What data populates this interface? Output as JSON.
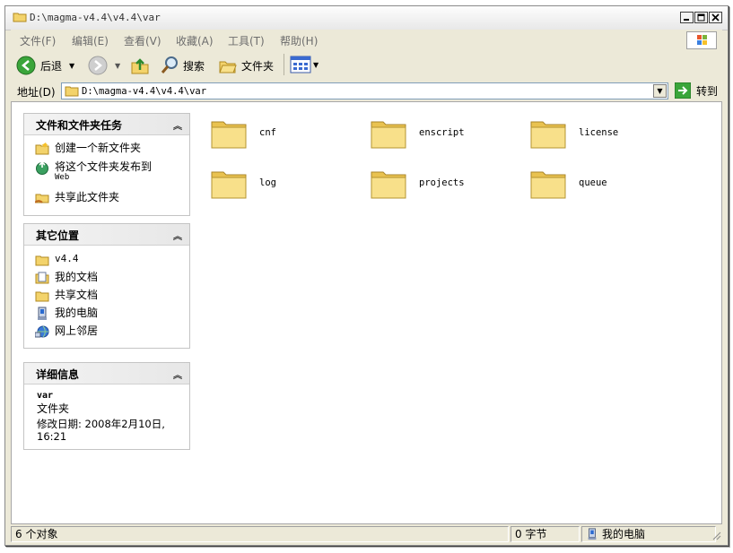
{
  "window": {
    "title": "D:\\magma-v4.4\\v4.4\\var"
  },
  "menu": {
    "file": "文件(F)",
    "edit": "编辑(E)",
    "view": "查看(V)",
    "favorites": "收藏(A)",
    "tools": "工具(T)",
    "help": "帮助(H)"
  },
  "toolbar": {
    "back": "后退",
    "search": "搜索",
    "folders": "文件夹"
  },
  "address": {
    "label": "地址(D)",
    "value": "D:\\magma-v4.4\\v4.4\\var",
    "go": "转到"
  },
  "tasks_panel": {
    "title": "文件和文件夹任务",
    "items": [
      {
        "label": "创建一个新文件夹",
        "icon": "new-folder-icon"
      },
      {
        "label": "将这个文件夹发布到",
        "label2": "Web",
        "icon": "publish-web-icon"
      },
      {
        "label": "共享此文件夹",
        "icon": "share-folder-icon"
      }
    ]
  },
  "places_panel": {
    "title": "其它位置",
    "items": [
      {
        "label": "v4.4",
        "icon": "folder-icon"
      },
      {
        "label": "我的文档",
        "icon": "my-documents-icon"
      },
      {
        "label": "共享文档",
        "icon": "shared-documents-icon"
      },
      {
        "label": "我的电脑",
        "icon": "my-computer-icon"
      },
      {
        "label": "网上邻居",
        "icon": "network-places-icon"
      }
    ]
  },
  "details_panel": {
    "title": "详细信息",
    "name": "var",
    "type": "文件夹",
    "modified_line1": "修改日期: 2008年2月10日,",
    "modified_line2": "16:21"
  },
  "folders": [
    "cnf",
    "enscript",
    "license",
    "log",
    "projects",
    "queue"
  ],
  "status": {
    "objects": "6 个对象",
    "size": "0 字节",
    "location": "我的电脑"
  }
}
